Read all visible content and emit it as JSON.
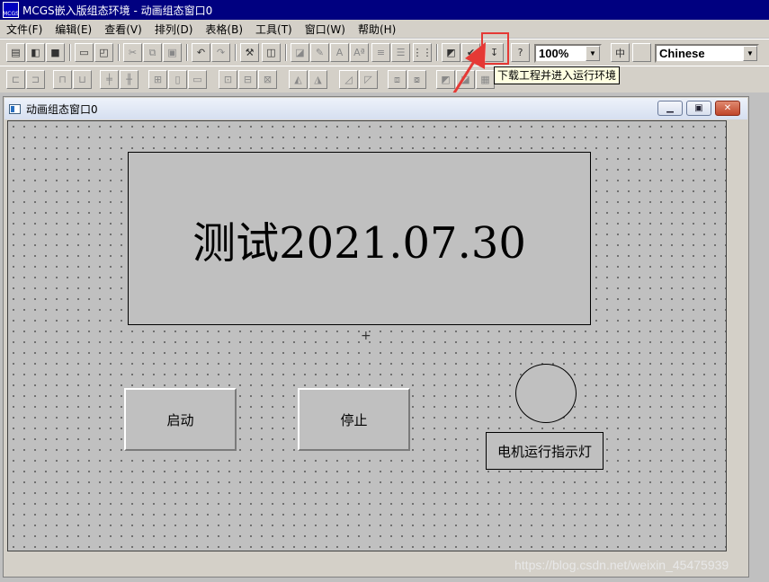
{
  "window": {
    "title": "MCGS嵌入版组态环境 - 动画组态窗口0",
    "icon_text": "MCGS"
  },
  "menu": [
    {
      "label": "文件(F)"
    },
    {
      "label": "编辑(E)"
    },
    {
      "label": "查看(V)"
    },
    {
      "label": "排列(D)"
    },
    {
      "label": "表格(B)"
    },
    {
      "label": "工具(T)"
    },
    {
      "label": "窗口(W)"
    },
    {
      "label": "帮助(H)"
    }
  ],
  "toolbar": {
    "zoom_value": "100%",
    "language_value": "Chinese",
    "download_tooltip": "下载工程并进入运行环境"
  },
  "child_window": {
    "title": "动画组态窗口0"
  },
  "canvas": {
    "label_text": "测试2021.07.30",
    "start_button": "启动",
    "stop_button": "停止",
    "lamp_label": "电机运行指示灯"
  },
  "watermark": "https://blog.csdn.net/weixin_45475939",
  "colors": {
    "title_bar": "#000080",
    "annotation": "#e53935",
    "tooltip": "#ffffe1"
  }
}
